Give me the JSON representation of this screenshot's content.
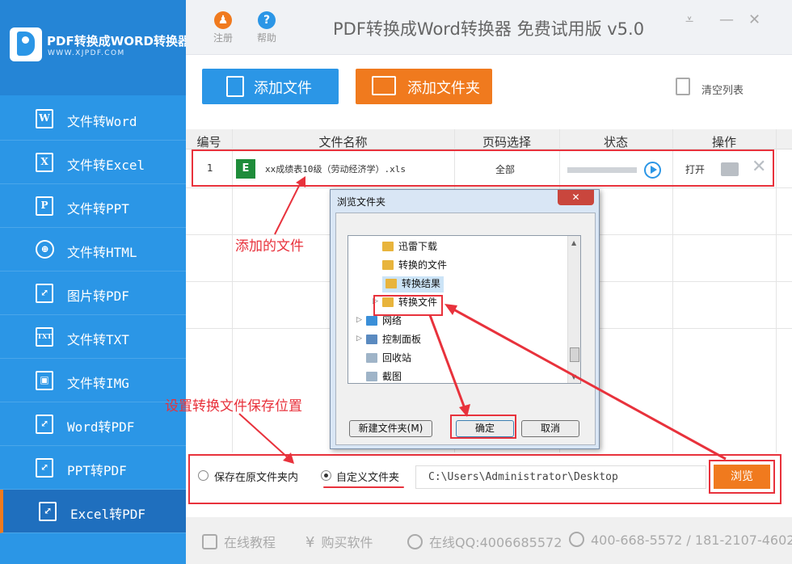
{
  "app": {
    "title": "PDF转换成Word转换器 免费试用版 v5.0",
    "brand_name": "PDF转换成WORD转换器",
    "brand_site": "WWW.XJPDF.COM",
    "register_label": "注册",
    "help_label": "帮助"
  },
  "sidebar": {
    "items": [
      {
        "label": "文件转Word",
        "icon": "W"
      },
      {
        "label": "文件转Excel",
        "icon": "X"
      },
      {
        "label": "文件转PPT",
        "icon": "P"
      },
      {
        "label": "文件转HTML",
        "icon": "⊕"
      },
      {
        "label": "图片转PDF",
        "icon": "⤢"
      },
      {
        "label": "文件转TXT",
        "icon": "TXT"
      },
      {
        "label": "文件转IMG",
        "icon": "▣"
      },
      {
        "label": "Word转PDF",
        "icon": "⤢"
      },
      {
        "label": "PPT转PDF",
        "icon": "⤢"
      },
      {
        "label": "Excel转PDF",
        "icon": "⤢"
      }
    ],
    "active_index": 9
  },
  "toolbar": {
    "add_file": "添加文件",
    "add_folder": "添加文件夹",
    "clear_list": "清空列表"
  },
  "table": {
    "headers": [
      "编号",
      "文件名称",
      "页码选择",
      "状态",
      "操作"
    ],
    "rows": [
      {
        "index": "1",
        "file_icon": "E",
        "name": "xx成绩表10级（劳动经济学）.xls",
        "pages": "全部",
        "action_open": "打开"
      }
    ]
  },
  "annotations": {
    "added_file": "添加的文件",
    "set_location": "设置转换文件保存位置"
  },
  "save": {
    "option_original": "保存在原文件夹内",
    "option_custom": "自定义文件夹",
    "selected": "custom",
    "path": "C:\\Users\\Administrator\\Desktop",
    "browse": "浏览"
  },
  "footer": {
    "tutorial": "在线教程",
    "buy": "购买软件",
    "qq": "在线QQ:4006685572",
    "phone": "400-668-5572 / 181-2107-4602"
  },
  "dialog": {
    "title": "浏览文件夹",
    "close": "✕",
    "tree": [
      "迅雷下载",
      "转换的文件",
      "转换结果",
      "转换文件",
      "网络",
      "控制面板",
      "回收站",
      "截图"
    ],
    "selected_index": 2,
    "new_folder": "新建文件夹(M)",
    "ok": "确定",
    "cancel": "取消"
  },
  "colors": {
    "sidebar": "#2b96e6",
    "accent_orange": "#f07a1e",
    "annotation_red": "#e8323c"
  }
}
